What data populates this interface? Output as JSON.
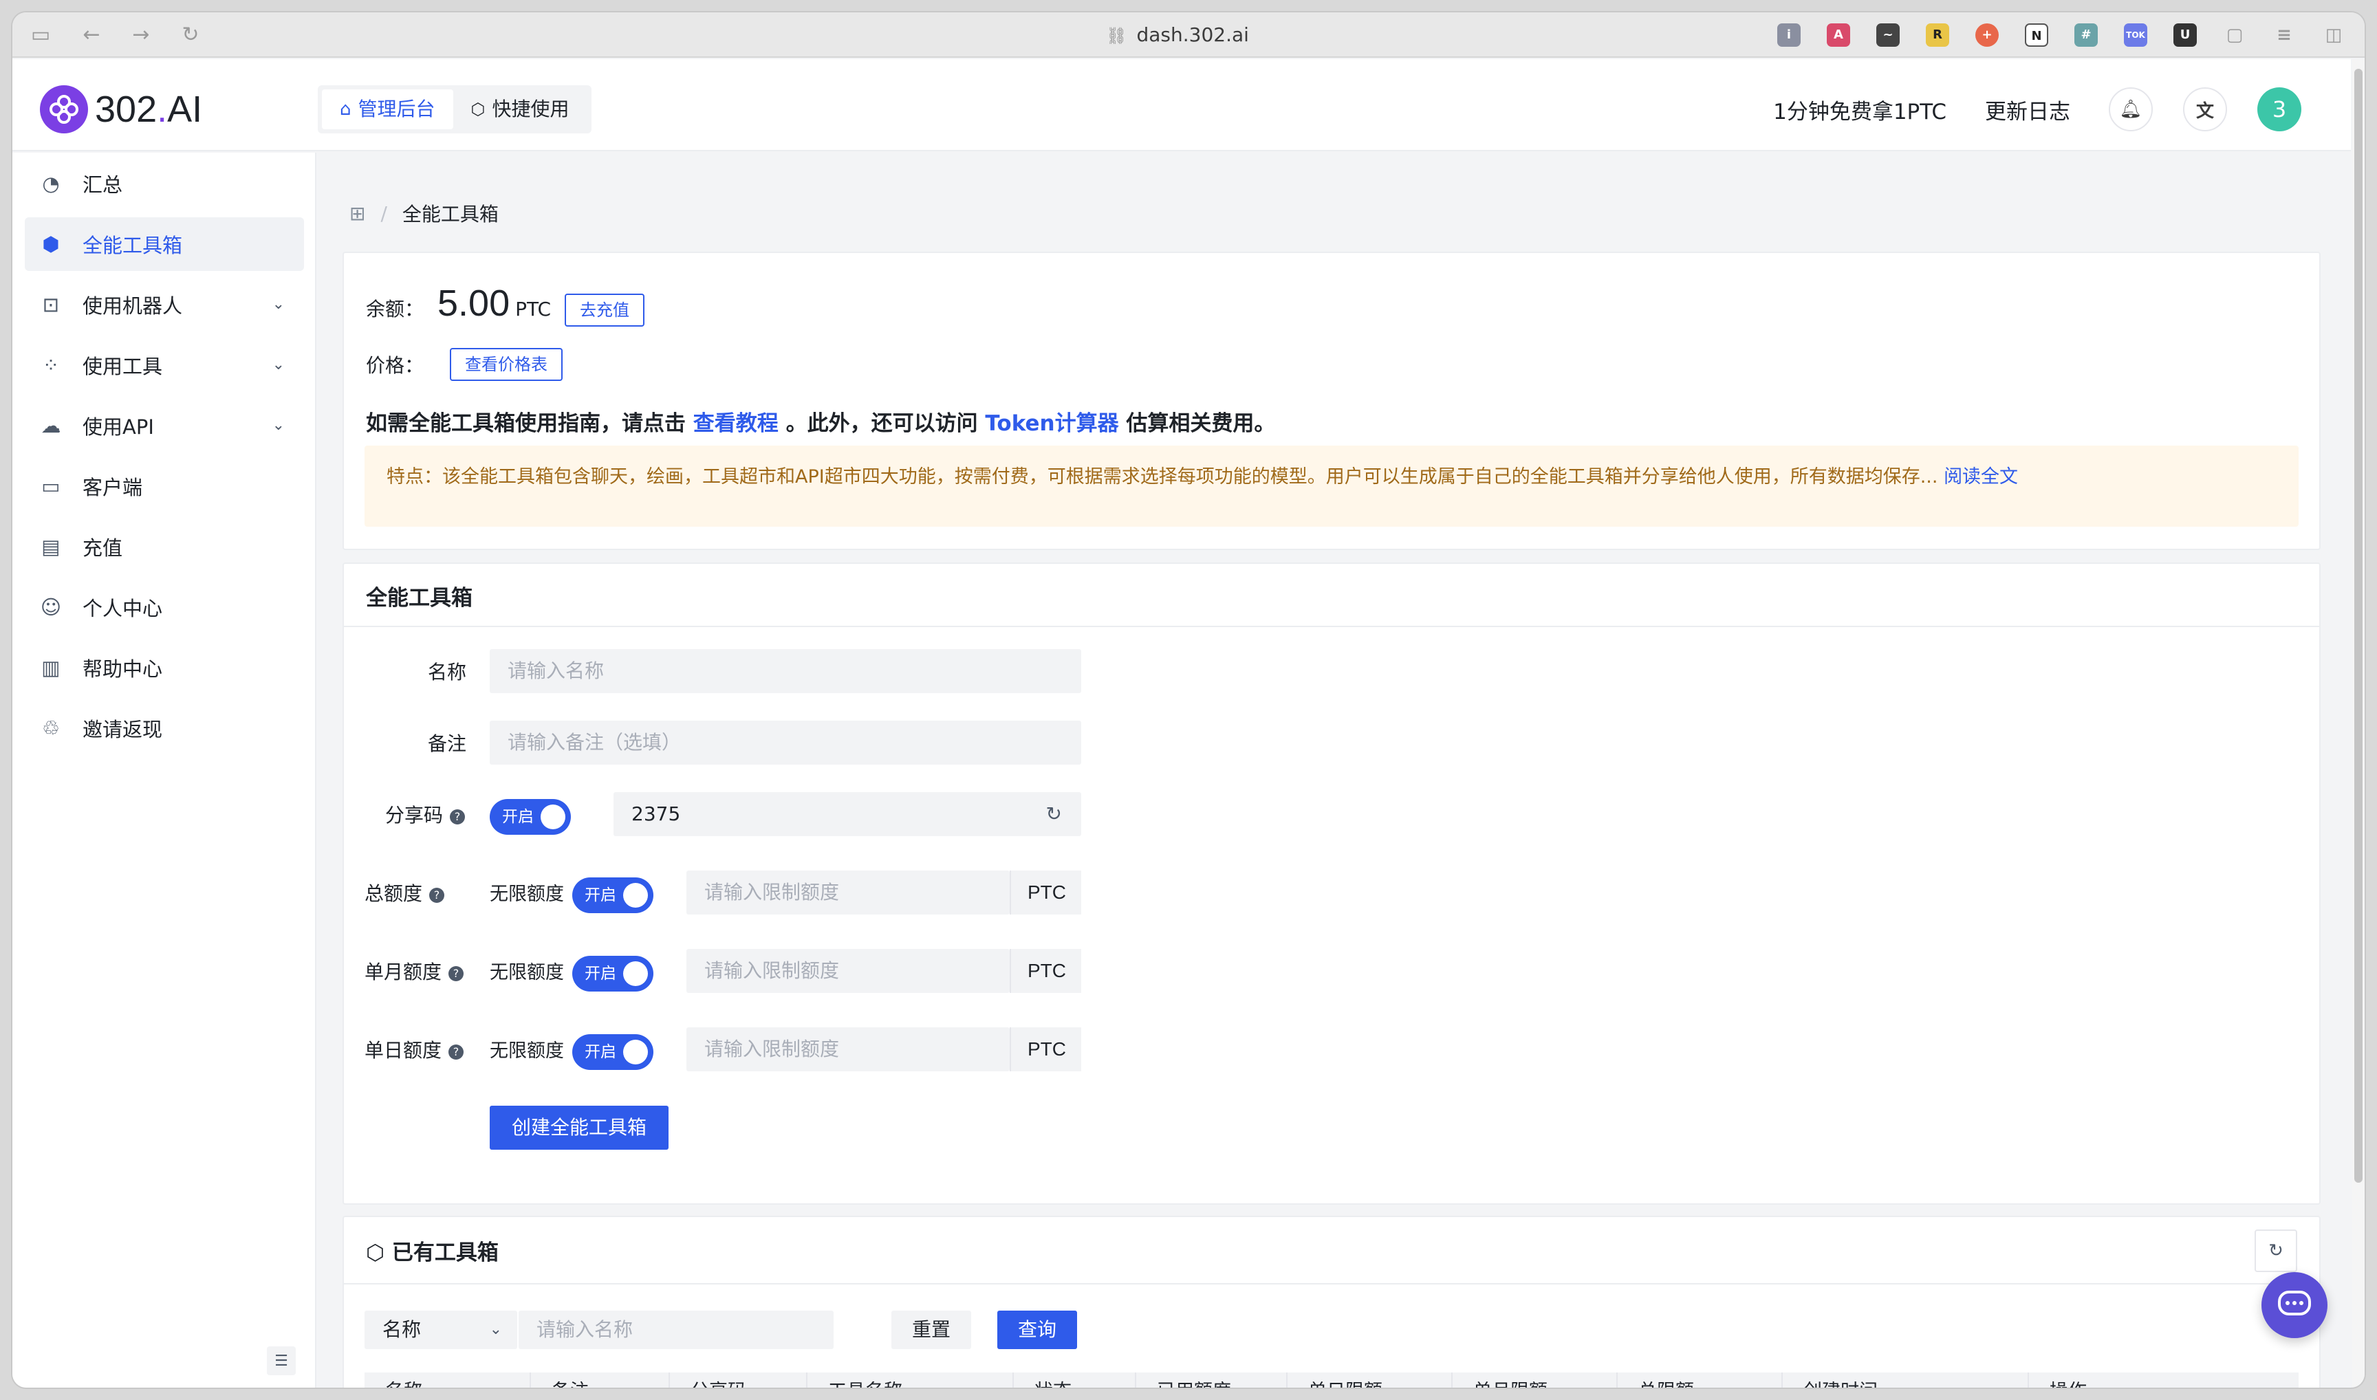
{
  "browser": {
    "url": "dash.302.ai"
  },
  "header": {
    "logo": "302.AI",
    "tabs": [
      {
        "label": "管理后台",
        "active": true
      },
      {
        "label": "快捷使用",
        "active": false
      }
    ],
    "free_link": "1分钟免费拿1PTC",
    "changelog": "更新日志",
    "avatar": "3"
  },
  "sidebar": {
    "items": [
      {
        "label": "汇总",
        "icon": "dashboard-icon"
      },
      {
        "label": "全能工具箱",
        "icon": "cube-icon",
        "active": true
      },
      {
        "label": "使用机器人",
        "icon": "robot-icon",
        "expandable": true
      },
      {
        "label": "使用工具",
        "icon": "apps-icon",
        "expandable": true
      },
      {
        "label": "使用API",
        "icon": "cloud-icon",
        "expandable": true
      },
      {
        "label": "客户端",
        "icon": "monitor-icon"
      },
      {
        "label": "充值",
        "icon": "card-icon"
      },
      {
        "label": "个人中心",
        "icon": "user-icon"
      },
      {
        "label": "帮助中心",
        "icon": "book-icon"
      },
      {
        "label": "邀请返现",
        "icon": "gift-icon"
      }
    ]
  },
  "breadcrumb": {
    "current": "全能工具箱"
  },
  "overview": {
    "balance_label": "余额：",
    "balance_value": "5.00",
    "balance_unit": "PTC",
    "recharge_btn": "去充值",
    "price_label": "价格：",
    "price_btn": "查看价格表",
    "info_prefix": "如需全能工具箱使用指南，请点击",
    "info_link1": "查看教程",
    "info_mid": "。此外，还可以访问",
    "info_link2": "Token计算器",
    "info_suffix": "估算相关费用。",
    "notice_text": "特点：该全能工具箱包含聊天，绘画，工具超市和API超市四大功能，按需付费，可根据需求选择每项功能的模型。用户可以生成属于自己的全能工具箱并分享给他人使用，所有数据均保存...",
    "notice_link": "阅读全文"
  },
  "form": {
    "title": "全能工具箱",
    "name_label": "名称",
    "name_placeholder": "请输入名称",
    "note_label": "备注",
    "note_placeholder": "请输入备注（选填）",
    "share_label": "分享码",
    "share_toggle": "开启",
    "share_code": "2375",
    "total_label": "总额度",
    "month_label": "单月额度",
    "day_label": "单日额度",
    "unlimited": "无限额度",
    "toggle_on": "开启",
    "limit_placeholder": "请输入限制额度",
    "unit": "PTC",
    "create_btn": "创建全能工具箱"
  },
  "list": {
    "title": "已有工具箱",
    "filter_select": "名称",
    "filter_placeholder": "请输入名称",
    "reset_btn": "重置",
    "query_btn": "查询",
    "columns": [
      "名称",
      "备注",
      "分享码",
      "工具名称",
      "状态",
      "已用额度",
      "单日限额",
      "单月限额",
      "总限额",
      "创建时间",
      "操作"
    ]
  }
}
